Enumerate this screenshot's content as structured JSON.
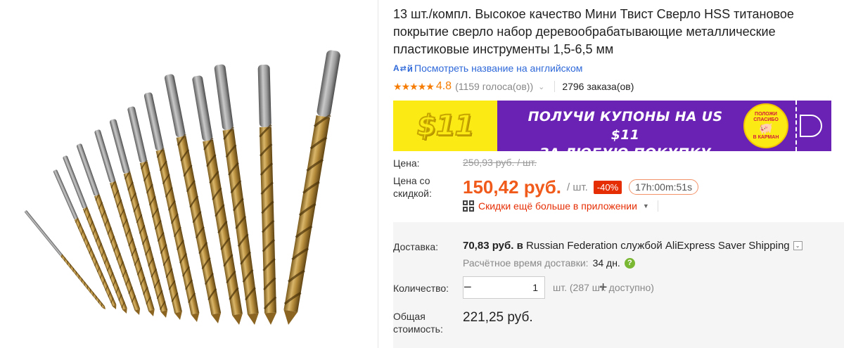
{
  "product": {
    "title": "13 шт./компл. Высокое качество Мини Твист Сверло HSS титановое покрытие сверло набор деревообрабатывающие металлические пластиковые инструменты 1,5-6,5 мм",
    "translate_link": "Посмотреть название на английском",
    "translate_icon": "translate-icon",
    "rating": {
      "stars_filled": 5,
      "value": "4.8",
      "votes": "(1159 голоса(ов))",
      "orders": "2796 заказа(ов)"
    }
  },
  "coupon": {
    "amount": "$11",
    "text_line1": "ПОЛУЧИ КУПОНЫ НА US $11",
    "text_line2": "ЗА ЛЮБУЮ ПОКУПКУ",
    "badge_text_top": "ПОЛОЖИ СПАСИБО",
    "badge_text_bottom": "В КАРМАН",
    "colors": {
      "yellow": "#fbea14",
      "purple": "#6a22b4"
    }
  },
  "price": {
    "label": "Цена:",
    "old_price": "250,93 руб. / шт.",
    "discount_label": "Цена со скидкой:",
    "new_price": "150,42 руб.",
    "per_unit": "/ шт.",
    "discount_badge": "-40%",
    "timer": "17h:00m:51s",
    "app_promo": "Скидки ещё больше в приложении",
    "accent_color": "#f05a1a"
  },
  "shipping": {
    "label": "Доставка:",
    "cost": "70,83 руб.",
    "in_word": "в",
    "destination_text": "Russian Federation службой AliExpress Saver Shipping",
    "eta_label": "Расчётное время доставки:",
    "eta_value": "34 дн."
  },
  "quantity": {
    "label": "Количество:",
    "value": "1",
    "decrement": "−",
    "increment": "+",
    "available": "шт. (287 шт. доступно)"
  },
  "total": {
    "label": "Общая стоимость:",
    "value": "221,25 руб."
  }
}
